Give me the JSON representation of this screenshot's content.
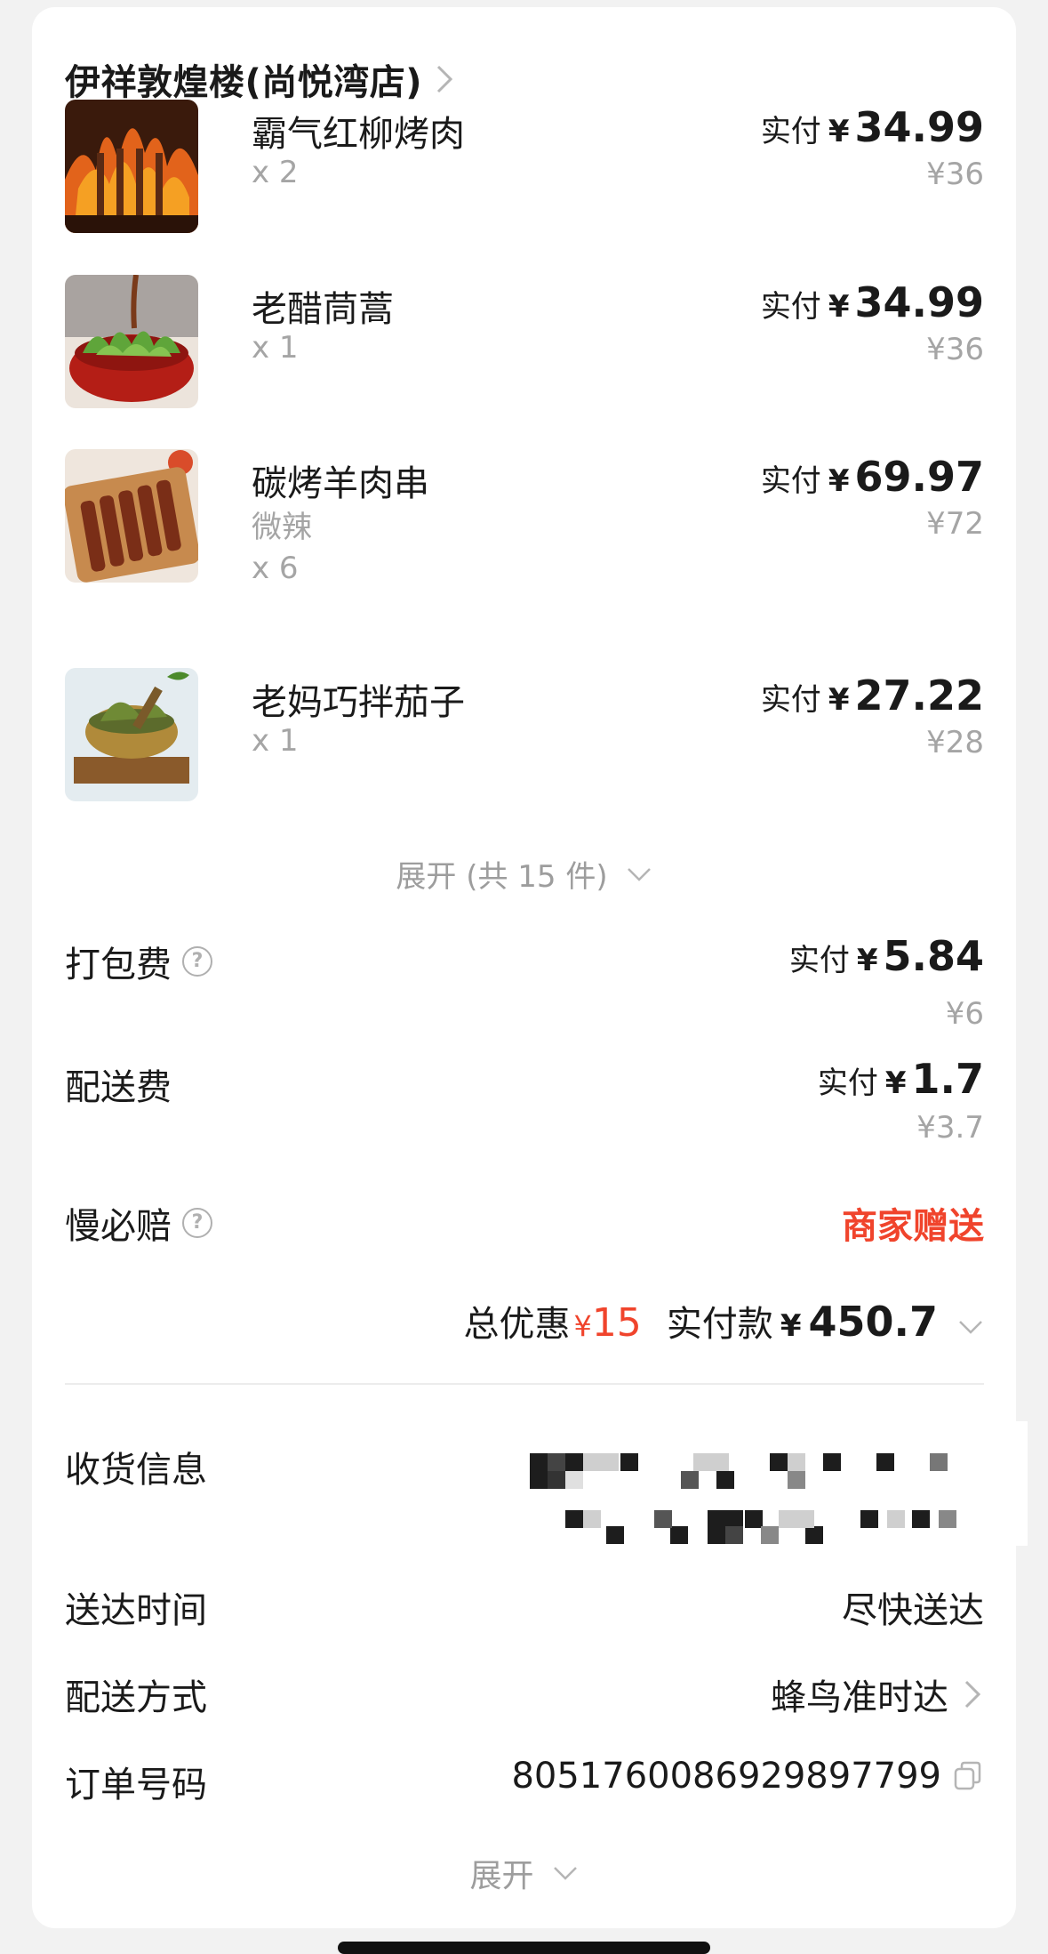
{
  "store": {
    "name": "伊祥敦煌楼(尚悦湾店)"
  },
  "items": [
    {
      "name": "霸气红柳烤肉",
      "spec": "",
      "qty": "x 2",
      "pay_label": "实付",
      "currency": "¥",
      "paid": "34.99",
      "original": "¥36"
    },
    {
      "name": "老醋茼蒿",
      "spec": "",
      "qty": "x 1",
      "pay_label": "实付",
      "currency": "¥",
      "paid": "34.99",
      "original": "¥36"
    },
    {
      "name": "碳烤羊肉串",
      "spec": "微辣",
      "qty": "x 6",
      "pay_label": "实付",
      "currency": "¥",
      "paid": "69.97",
      "original": "¥72"
    },
    {
      "name": "老妈巧拌茄子",
      "spec": "",
      "qty": "x 1",
      "pay_label": "实付",
      "currency": "¥",
      "paid": "27.22",
      "original": "¥28"
    }
  ],
  "expand_items": {
    "label": "展开 (共 15 件)"
  },
  "fees": {
    "packing": {
      "label": "打包费",
      "pay_label": "实付",
      "currency": "¥",
      "paid": "5.84",
      "original": "¥6"
    },
    "delivery": {
      "label": "配送费",
      "pay_label": "实付",
      "currency": "¥",
      "paid": "1.7",
      "original": "¥3.7"
    },
    "late_compensation": {
      "label": "慢必赔",
      "value": "商家赠送"
    }
  },
  "totals": {
    "discount_label": "总优惠",
    "discount_currency": "¥",
    "discount_value": "15",
    "paid_label": "实付款",
    "paid_currency": "¥",
    "paid_value": "450.7"
  },
  "info": {
    "address_label": "收货信息",
    "delivery_time_label": "送达时间",
    "delivery_time_value": "尽快送达",
    "delivery_method_label": "配送方式",
    "delivery_method_value": "蜂鸟准时达",
    "order_number_label": "订单号码",
    "order_number_value": "8051760086929897799"
  },
  "expand_bottom": {
    "label": "展开"
  },
  "colors": {
    "accent_red": "#f0442c",
    "muted": "#a5a5a5",
    "background": "#f2f2f2"
  }
}
